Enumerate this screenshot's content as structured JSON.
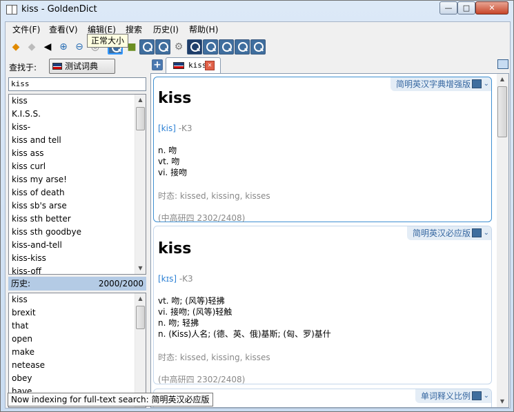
{
  "window": {
    "title": "kiss - GoldenDict",
    "min": "—",
    "max": "□",
    "close": "✕"
  },
  "menu": [
    "文件(F)",
    "查看(V)",
    "编辑(E)",
    "搜索",
    "历史(I)",
    "帮助(H)"
  ],
  "toolbar": {
    "tooltip": "正常大小",
    "icons": [
      "back-arrow-icon",
      "forward-arrow-icon",
      "speaker-icon",
      "zoom-in-icon",
      "zoom-out-icon",
      "zoom-reset-icon",
      "dictionary-icon",
      "books-icon",
      "dictionary-icon",
      "dictionary-icon",
      "gear-icon",
      "dictionary-icon",
      "dictionary-icon",
      "dictionary-icon",
      "dictionary-icon",
      "dictionary-icon"
    ]
  },
  "left": {
    "find_label": "查找于:",
    "group": "测试词典",
    "search_value": "kiss",
    "words": [
      "kiss",
      "K.I.S.S.",
      "kiss-",
      "kiss and tell",
      "kiss ass",
      "kiss curl",
      "kiss my arse!",
      "kiss of death",
      "kiss sb's arse",
      "kiss sth better",
      "kiss sth goodbye",
      "kiss-and-tell",
      "kiss-kiss",
      "kiss-off"
    ],
    "history_label": "历史:",
    "history_count": "2000/2000",
    "history": [
      "kiss",
      "brexit",
      "that",
      "open",
      "make",
      "netease",
      "obey",
      "have"
    ]
  },
  "tab": {
    "label": "kiss",
    "close": "✕",
    "new": "+"
  },
  "articles": [
    {
      "dict": "简明英汉字典增强版",
      "headword": "kiss",
      "phonetic": "[kis]",
      "level": " -K3",
      "senses": [
        "n. 吻",
        "vt. 吻",
        "vi. 接吻"
      ],
      "forms": "时态: kissed, kissing, kisses",
      "freq": "(中高研四 2302/2408)"
    },
    {
      "dict": "简明英汉必应版",
      "headword": "kiss",
      "phonetic": "[kɪs]",
      "level": " -K3",
      "senses": [
        "vt. 吻; (风等)轻拂",
        "vi. 接吻; (风等)轻触",
        "n. 吻; 轻拂",
        "n. (Kiss)人名; (德、英、俄)基斯; (匈、罗)基什"
      ],
      "forms": "时态: kissed, kissing, kisses",
      "freq": "(中高研四 2302/2408)"
    },
    {
      "dict": "单词释义比例"
    }
  ],
  "status": "Now indexing for full-text search: 简明英汉必应版"
}
